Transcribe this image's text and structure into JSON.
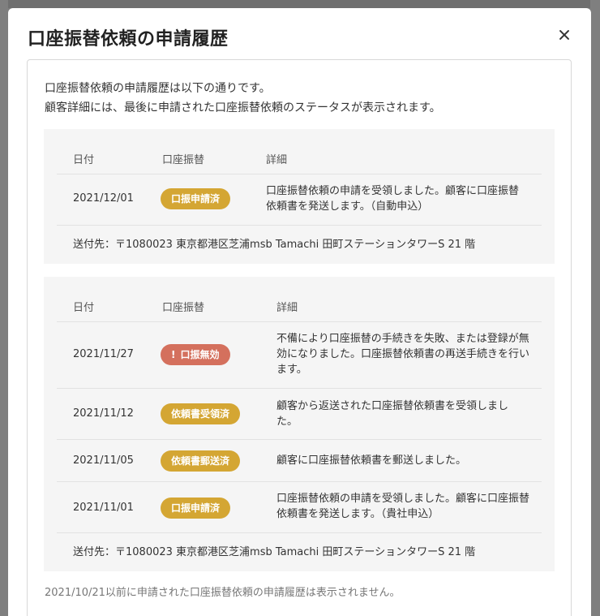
{
  "modal": {
    "title": "口座振替依頼の申請履歴",
    "close_icon": "close-icon",
    "intro": [
      "口座振替依頼の申請履歴は以下の通りです。",
      "顧客詳細には、最後に申請された口座振替依頼のステータスが表示されます。"
    ],
    "columns": {
      "date": "日付",
      "status": "口座振替",
      "detail": "詳細"
    },
    "latest": {
      "rows": [
        {
          "date": "2021/12/01",
          "badge": "口振申請済",
          "badge_color": "#d4a633",
          "detail": "口座振替依頼の申請を受領しました。顧客に口座振替依頼書を発送します。（自動申込）"
        }
      ],
      "address": "送付先：〒1080023 東京都港区芝浦msb Tamachi 田町ステーションタワーS 21 階"
    },
    "previous": {
      "rows": [
        {
          "date": "2021/11/27",
          "badge": "口振無効",
          "badge_icon": "!",
          "badge_color": "#d4705d",
          "detail": "不備により口座振替の手続きを失敗、または登録が無効になりました。口座振替依頼書の再送手続きを行います。"
        },
        {
          "date": "2021/11/12",
          "badge": "依頼書受領済",
          "badge_color": "#d4a633",
          "detail": "顧客から返送された口座振替依頼書を受領しました。"
        },
        {
          "date": "2021/11/05",
          "badge": "依頼書郵送済",
          "badge_color": "#d4a633",
          "detail": "顧客に口座振替依頼書を郵送しました。"
        },
        {
          "date": "2021/11/01",
          "badge": "口振申請済",
          "badge_color": "#d4a633",
          "detail": "口座振替依頼の申請を受領しました。顧客に口座振替依頼書を発送します。（貴社申込）"
        }
      ],
      "address": "送付先：〒1080023 東京都港区芝浦msb Tamachi 田町ステーションタワーS 21 階"
    },
    "footnote": "2021/10/21以前に申請された口座振替依頼の申請履歴は表示されません。"
  }
}
